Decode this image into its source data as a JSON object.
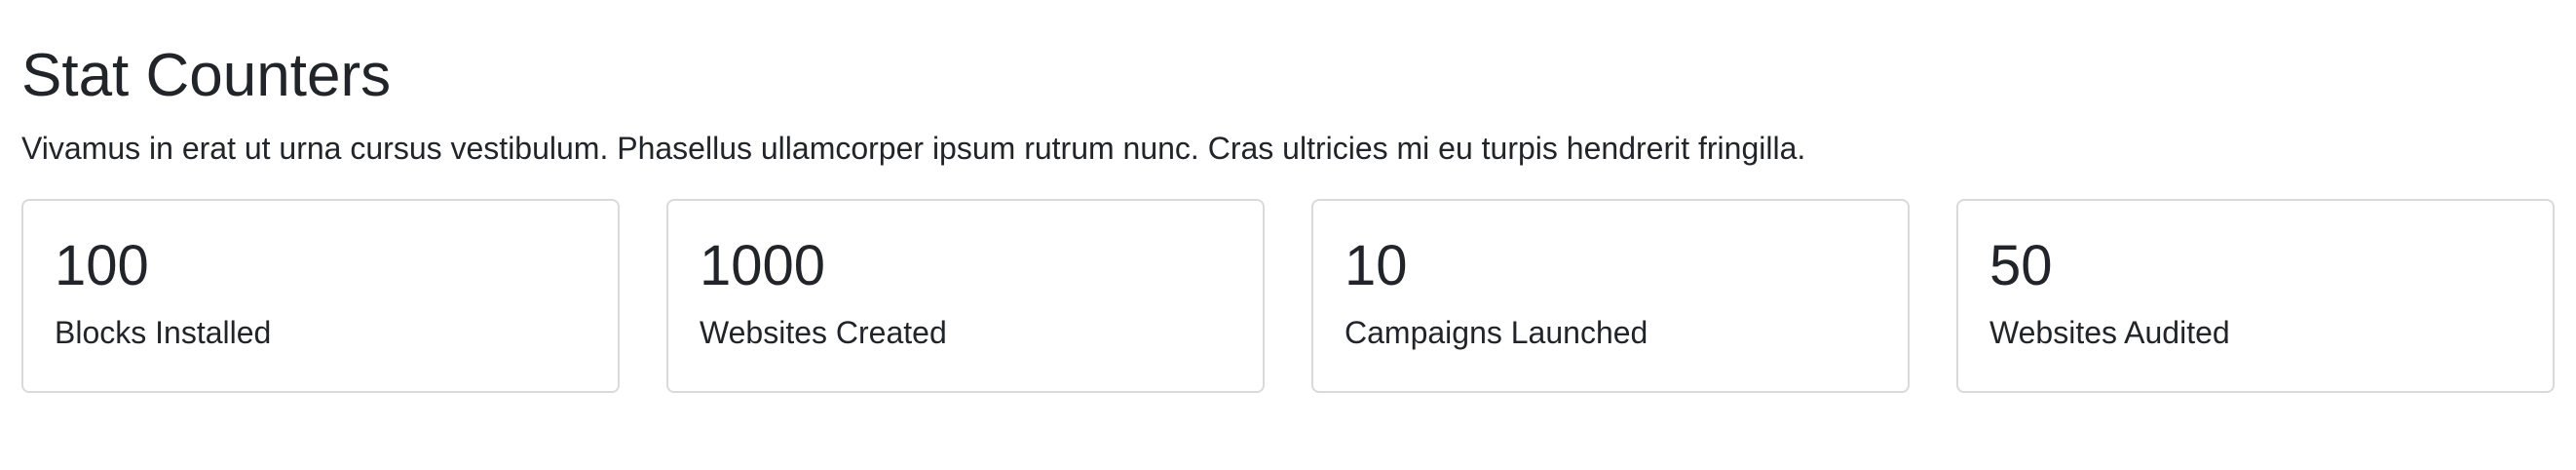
{
  "page": {
    "title": "Stat Counters",
    "lead": "Vivamus in erat ut urna cursus vestibulum. Phasellus ullamcorper ipsum rutrum nunc. Cras ultricies mi eu turpis hendrerit fringilla."
  },
  "stats": [
    {
      "value": "100",
      "label": "Blocks Installed"
    },
    {
      "value": "1000",
      "label": "Websites Created"
    },
    {
      "value": "10",
      "label": "Campaigns Launched"
    },
    {
      "value": "50",
      "label": "Websites Audited"
    }
  ]
}
